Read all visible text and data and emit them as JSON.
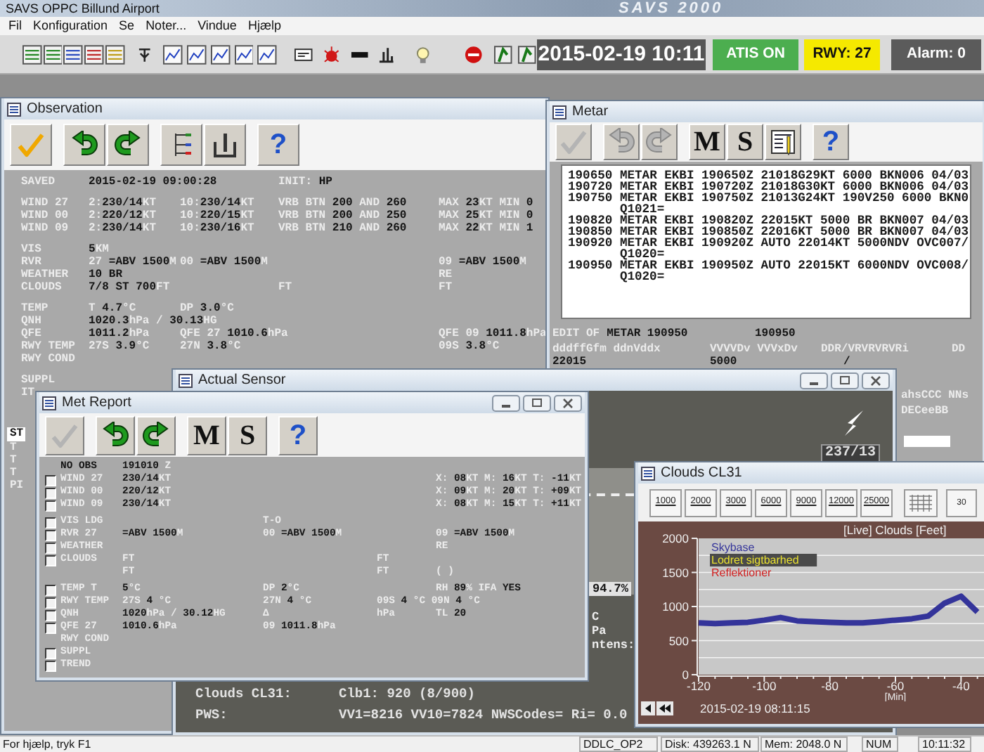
{
  "window": {
    "title": "SAVS OPPC Billund Airport",
    "title_art": "SAVS 2000"
  },
  "menu": [
    "Fil",
    "Konfiguration",
    "Se",
    "Noter...",
    "Vindue",
    "Hjælp"
  ],
  "toolbar": {
    "datetime": "2015-02-19 10:11",
    "badges": [
      {
        "text": "ATIS ON",
        "color": "#4cae4f"
      },
      {
        "text": "RWY: 27",
        "color": "#f5e900"
      },
      {
        "text": "Alarm: 0",
        "color": "#5b5b5b"
      }
    ]
  },
  "observation": {
    "title": "Observation",
    "window_buttons": false,
    "tools": [
      {
        "kind": "confirm",
        "disabled": false
      },
      {
        "kind": "undo",
        "disabled": false
      },
      {
        "kind": "redo",
        "disabled": false
      },
      {
        "kind": "tree",
        "disabled": false
      },
      {
        "kind": "gauge",
        "disabled": false
      },
      {
        "kind": "help",
        "glyph": "?",
        "disabled": false
      }
    ],
    "groups": [
      [
        {
          "label": {
            "text": "SAVED",
            "kind": "label"
          },
          "col_1": {
            "text": "2015-02-19 09:00:28",
            "kind": "value"
          },
          "col_3": {
            "text": "INIT: **HP**",
            "kind": "mixed"
          }
        }
      ],
      [
        {
          "label": {
            "text": "WIND 27",
            "kind": "label"
          },
          "col_1": {
            "text": "2:**230/14**KT",
            "kind": "mixed"
          },
          "col_2": {
            "text": "10:**230/14**KT",
            "kind": "mixed"
          },
          "col_3": {
            "text": "VRB BTN **200** AND **260**",
            "kind": "mixed"
          },
          "col_4": {
            "text": "MAX **23**KT MIN **0**",
            "kind": "mixed"
          }
        },
        {
          "label": {
            "text": "WIND 00",
            "kind": "label"
          },
          "col_1": {
            "text": "2:**220/12**KT",
            "kind": "mixed"
          },
          "col_2": {
            "text": "10:**220/15**KT",
            "kind": "mixed"
          },
          "col_3": {
            "text": "VRB BTN **200** AND **250**",
            "kind": "mixed"
          },
          "col_4": {
            "text": "MAX **25**KT MIN **0**",
            "kind": "mixed"
          }
        },
        {
          "label": {
            "text": "WIND 09",
            "kind": "label"
          },
          "col_1": {
            "text": "2:**230/14**KT",
            "kind": "mixed"
          },
          "col_2": {
            "text": "10:**230/16**KT",
            "kind": "mixed"
          },
          "col_3": {
            "text": "VRB BTN **210** AND **260**",
            "kind": "mixed"
          },
          "col_4": {
            "text": "MAX **22**KT MIN **1**",
            "kind": "mixed"
          }
        }
      ],
      [
        {
          "label": {
            "text": "VIS",
            "kind": "label"
          },
          "col_1": {
            "text": "**5**KM",
            "kind": "mixed"
          }
        },
        {
          "label": {
            "text": "RVR",
            "kind": "label"
          },
          "col_1": {
            "text": "27 **=ABV 1500**M",
            "kind": "mixed"
          },
          "col_2": {
            "text": "00 **=ABV 1500**M",
            "kind": "mixed"
          },
          "col_4": {
            "text": "09 **=ABV 1500**M",
            "kind": "mixed"
          }
        },
        {
          "label": {
            "text": "WEATHER",
            "kind": "label"
          },
          "col_1": {
            "text": "10 BR",
            "kind": "value"
          },
          "col_4": {
            "text": "RE",
            "kind": "label"
          }
        },
        {
          "label": {
            "text": "CLOUDS",
            "kind": "label"
          },
          "col_1": {
            "text": "**7/8 ST 700**FT",
            "kind": "mixed"
          },
          "col_3": {
            "text": "FT",
            "kind": "label"
          },
          "col_4": {
            "text": "FT",
            "kind": "label"
          }
        }
      ],
      [
        {
          "label": {
            "text": "TEMP",
            "kind": "label"
          },
          "col_1": {
            "text": "T **4.7**°C",
            "kind": "mixed"
          },
          "col_2": {
            "text": "DP **3.0**°C",
            "kind": "mixed"
          }
        },
        {
          "label": {
            "text": "QNH",
            "kind": "label"
          },
          "col_1": {
            "text": "**1020.3**hPa / **30.13**HG",
            "kind": "mixed"
          }
        },
        {
          "label": {
            "text": "QFE",
            "kind": "label"
          },
          "col_1": {
            "text": "**1011.2**hPa",
            "kind": "mixed"
          },
          "col_2": {
            "text": "QFE 27 **1010.6**hPa",
            "kind": "mixed"
          },
          "col_4": {
            "text": "QFE 09 **1011.8**hPa",
            "kind": "mixed"
          }
        },
        {
          "label": {
            "text": "RWY TEMP",
            "kind": "label"
          },
          "col_1": {
            "text": "27S **3.9**°C",
            "kind": "mixed"
          },
          "col_2": {
            "text": "27N **3.8**°C",
            "kind": "mixed"
          },
          "col_4": {
            "text": "09S **3.8**°C",
            "kind": "mixed"
          }
        },
        {
          "label": {
            "text": "RWY COND",
            "kind": "label"
          }
        }
      ],
      [
        {
          "label": {
            "text": "SUPPL",
            "kind": "label"
          }
        },
        {
          "label": {
            "text": "IT",
            "kind": "label"
          }
        }
      ]
    ],
    "lower": [
      {
        "text": "ST",
        "kind": "header"
      },
      {
        "text": "T",
        "kind": "line"
      },
      {
        "text": "T",
        "kind": "line"
      },
      {
        "text": "T",
        "kind": "line"
      },
      {
        "text": "PI",
        "kind": "line"
      }
    ]
  },
  "metar": {
    "title": "Metar",
    "window_buttons": false,
    "tools": [
      {
        "kind": "confirm",
        "disabled": true
      },
      {
        "kind": "undo",
        "disabled": true
      },
      {
        "kind": "redo",
        "disabled": true
      },
      {
        "kind": "letter",
        "glyph": "M",
        "disabled": false
      },
      {
        "kind": "letter",
        "glyph": "S",
        "disabled": false
      },
      {
        "kind": "edit",
        "disabled": false
      },
      {
        "kind": "help",
        "glyph": "?",
        "disabled": false
      }
    ],
    "messages": [
      {
        "text": "190650 METAR EKBI 190650Z 21018G29KT 6000 BKN006 04/03",
        "kind": "line"
      },
      {
        "text": "190720 METAR EKBI 190720Z 21018G30KT 6000 BKN006 04/03",
        "kind": "line"
      },
      {
        "text": "190750 METAR EKBI 190750Z 21013G24KT 190V250 6000 BKN0",
        "kind": "line"
      },
      {
        "text": "Q1021=",
        "kind": "continuation"
      },
      {
        "text": "190820 METAR EKBI 190820Z 22015KT 5000 BR BKN007 04/03",
        "kind": "line"
      },
      {
        "text": "190850 METAR EKBI 190850Z 22016KT 5000 BR BKN007 04/03",
        "kind": "line"
      },
      {
        "text": "190920 METAR EKBI 190920Z AUTO 22014KT 5000NDV OVC007/",
        "kind": "line"
      },
      {
        "text": "Q1020=",
        "kind": "continuation"
      },
      {
        "text": "190950 METAR EKBI 190950Z AUTO 22015KT 6000NDV OVC008/",
        "kind": "line"
      },
      {
        "text": "Q1020=",
        "kind": "continuation"
      }
    ],
    "edit_header": {
      "label": "EDIT OF",
      "value": "METAR 190950",
      "ref": "190950"
    },
    "columns": [
      "dddffGfm ddnVddx",
      "VVVVDv VVVxDv",
      "DDR/VRVRVRVRi",
      "DD"
    ],
    "values": [
      "22015",
      "5000",
      "/"
    ],
    "side_lines": [
      "ahsCCC NNs",
      "DECeeBB"
    ]
  },
  "actual_sensor": {
    "title": "Actual Sensor",
    "window_buttons": true,
    "wind_readout": "237/13",
    "percent": "94.7%",
    "fragments": [
      "C",
      "Pa",
      "ntens:"
    ],
    "lines": [
      {
        "label": "Clouds CL31:",
        "value": "Clb1: 920 (8/900)"
      },
      {
        "label": "PWS:",
        "value": "VV1=8216 VV10=7824 NWSCodes= Ri= 0.0"
      }
    ]
  },
  "met_report": {
    "title": "Met Report",
    "window_buttons": true,
    "tools": [
      {
        "kind": "confirm",
        "disabled": true
      },
      {
        "kind": "undo",
        "disabled": false
      },
      {
        "kind": "redo",
        "disabled": false
      },
      {
        "kind": "letter",
        "glyph": "M",
        "disabled": false
      },
      {
        "kind": "letter",
        "glyph": "S",
        "disabled": false
      },
      {
        "kind": "help",
        "glyph": "?",
        "disabled": false
      }
    ],
    "groups": [
      [
        {
          "kind": "plain",
          "label": {
            "text": "NO OBS",
            "kind": "value"
          },
          "col_1": {
            "text": "**191010** Z",
            "kind": "mixed"
          }
        },
        {
          "kind": "check",
          "checked": false,
          "label": {
            "text": "WIND 27",
            "kind": "label"
          },
          "col_1": {
            "text": "**230/14**KT",
            "kind": "mixed"
          },
          "col_4": {
            "text": "X: **08**KT M: **16**KT T: **-11**KT",
            "kind": "mixed"
          }
        },
        {
          "kind": "check",
          "checked": false,
          "label": {
            "text": "WIND 00",
            "kind": "label"
          },
          "col_1": {
            "text": "**220/12**KT",
            "kind": "mixed"
          },
          "col_4": {
            "text": "X: **09**KT M: **20**KT T: **+09**KT",
            "kind": "mixed"
          }
        },
        {
          "kind": "check",
          "checked": false,
          "label": {
            "text": "WIND 09",
            "kind": "label"
          },
          "col_1": {
            "text": "**230/14**KT",
            "kind": "mixed"
          },
          "col_4": {
            "text": "X: **08**KT M: **15**KT T: **+11**KT",
            "kind": "mixed"
          }
        }
      ],
      [
        {
          "kind": "check",
          "checked": false,
          "label": {
            "text": "VIS LDG",
            "kind": "label"
          },
          "col_2": {
            "text": "T-O",
            "kind": "label"
          }
        },
        {
          "kind": "check",
          "checked": false,
          "label": {
            "text": "RVR 27",
            "kind": "label"
          },
          "col_1": {
            "text": "**=ABV 1500**M",
            "kind": "mixed"
          },
          "col_2": {
            "text": "00 **=ABV 1500**M",
            "kind": "mixed"
          },
          "col_4": {
            "text": "09 **=ABV 1500**M",
            "kind": "mixed"
          }
        },
        {
          "kind": "check",
          "checked": false,
          "label": {
            "text": "WEATHER",
            "kind": "label"
          },
          "col_4": {
            "text": "RE",
            "kind": "label"
          }
        },
        {
          "kind": "check",
          "checked": false,
          "label": {
            "text": "CLOUDS",
            "kind": "label"
          },
          "col_1": {
            "text": "FT",
            "kind": "label"
          },
          "col_3": {
            "text": "FT",
            "kind": "label"
          }
        },
        {
          "kind": "plain",
          "col_1": {
            "text": "FT",
            "kind": "label"
          },
          "col_3": {
            "text": "FT",
            "kind": "label"
          },
          "col_4": {
            "text": "( )",
            "kind": "label"
          }
        }
      ],
      [
        {
          "kind": "check",
          "checked": false,
          "label": {
            "text": "TEMP T",
            "kind": "label"
          },
          "col_1": {
            "text": "**5**°C",
            "kind": "mixed"
          },
          "col_2": {
            "text": "DP **2**°C",
            "kind": "mixed"
          },
          "col_4": {
            "text": "RH **89**% IFA **YES**",
            "kind": "mixed"
          }
        },
        {
          "kind": "check",
          "checked": false,
          "label": {
            "text": "RWY TEMP",
            "kind": "label"
          },
          "col_1": {
            "text": "27S **4** °C",
            "kind": "mixed"
          },
          "col_2": {
            "text": "27N **4** °C",
            "kind": "mixed"
          },
          "col_3": {
            "text": "09S **4** °C 09N **4** °C",
            "kind": "mixed"
          }
        },
        {
          "kind": "check",
          "checked": false,
          "label": {
            "text": "QNH",
            "kind": "label"
          },
          "col_1": {
            "text": "**1020**hPa / **30.12**HG",
            "kind": "mixed"
          },
          "col_2": {
            "text": "Δ",
            "kind": "label"
          },
          "col_3": {
            "text": "hPa",
            "kind": "label"
          },
          "col_4": {
            "text": "TL **20**",
            "kind": "mixed"
          }
        },
        {
          "kind": "check",
          "checked": false,
          "label": {
            "text": "QFE 27",
            "kind": "label"
          },
          "col_1": {
            "text": "**1010.6**hPa",
            "kind": "mixed"
          },
          "col_2": {
            "text": "09 **1011.8**hPa",
            "kind": "mixed"
          }
        },
        {
          "kind": "plain",
          "label": {
            "text": "RWY COND",
            "kind": "label"
          }
        },
        {
          "kind": "check",
          "checked": false,
          "label": {
            "text": "SUPPL",
            "kind": "label"
          }
        },
        {
          "kind": "check",
          "checked": false,
          "label": {
            "text": "TREND",
            "kind": "label"
          }
        }
      ]
    ]
  },
  "clouds": {
    "title": "Clouds CL31",
    "window_buttons": false,
    "scale_buttons": [
      "1000",
      "2000",
      "3000",
      "6000",
      "9000",
      "12000",
      "25000"
    ],
    "timer_button": "30",
    "timestamp": "2015-02-19 08:11:15",
    "chart_data": {
      "type": "line",
      "title": "[Live] Clouds [Feet]",
      "xlabel": "[Min]",
      "x": [
        -120,
        -115,
        -110,
        -105,
        -100,
        -95,
        -90,
        -85,
        -80,
        -75,
        -70,
        -65,
        -60,
        -55,
        -50,
        -45,
        -40,
        -35
      ],
      "series": [
        {
          "name": "Skybase",
          "color": "#34349a",
          "values": [
            760,
            750,
            760,
            770,
            800,
            840,
            790,
            780,
            770,
            760,
            760,
            780,
            800,
            820,
            860,
            1050,
            1150,
            920
          ]
        },
        {
          "name": "Lodret sigtbarhed",
          "color": "#e8e030",
          "values": [
            null,
            null,
            null,
            null,
            null,
            null,
            null,
            null,
            null,
            null,
            null,
            null,
            null,
            null,
            null,
            null,
            null,
            null
          ]
        },
        {
          "name": "Reflektioner",
          "color": "#d02020",
          "values": [
            null,
            null,
            null,
            null,
            null,
            null,
            null,
            null,
            null,
            null,
            null,
            null,
            null,
            null,
            null,
            null,
            null,
            null
          ]
        }
      ],
      "xlim": [
        -120,
        -33
      ],
      "xticks": [
        -120,
        -100,
        -80,
        -60,
        -40
      ],
      "yticks": [
        0,
        500,
        1000,
        1500,
        2000
      ],
      "ylim": [
        0,
        2000
      ],
      "grid": true
    }
  },
  "status_bar": {
    "hint": "For hjælp, tryk F1",
    "panes": [
      "DDLC_OP2",
      "Disk: 439263.1 N",
      "Mem: 2048.0 N",
      "NUM",
      "10:11:32"
    ]
  }
}
